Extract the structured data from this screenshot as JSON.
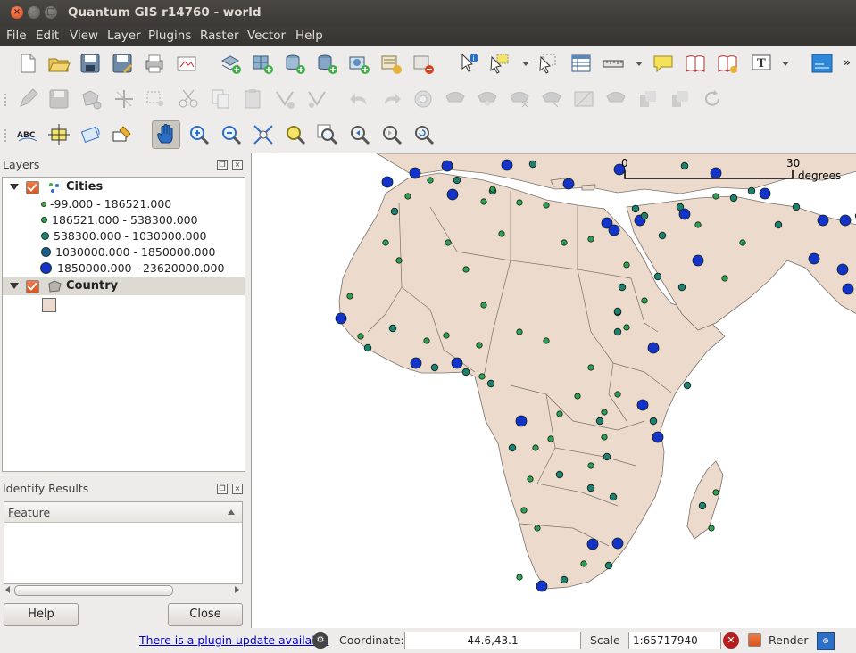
{
  "window": {
    "title": "Quantum GIS r14760 - world"
  },
  "menu": [
    "File",
    "Edit",
    "View",
    "Layer",
    "Plugins",
    "Raster",
    "Vector",
    "Help"
  ],
  "layers_panel": {
    "title": "Layers",
    "layers": [
      {
        "name": "Cities",
        "legend": [
          "-99.000 - 186521.000",
          "186521.000 - 538300.000",
          "538300.000 - 1030000.000",
          "1030000.000 - 1850000.000",
          "1850000.000 - 23620000.000"
        ]
      },
      {
        "name": "Country"
      }
    ]
  },
  "identify_panel": {
    "title": "Identify Results",
    "column": "Feature",
    "help": "Help",
    "close": "Close"
  },
  "map": {
    "land_color": "#ecdbcd",
    "border_color": "#7a726b",
    "city_colors": [
      "#3fae49",
      "#2f9f55",
      "#1f7f70",
      "#1a5e9a",
      "#1433c8"
    ],
    "scalebar": {
      "start": "0",
      "end": "30",
      "unit": "degrees"
    }
  },
  "status": {
    "plugin_link": "There is a plugin update available",
    "coordinate_label": "Coordinate:",
    "coordinate": "44.6,43.1",
    "scale_label": "Scale",
    "scale": "1:65717940",
    "render_label": "Render"
  }
}
